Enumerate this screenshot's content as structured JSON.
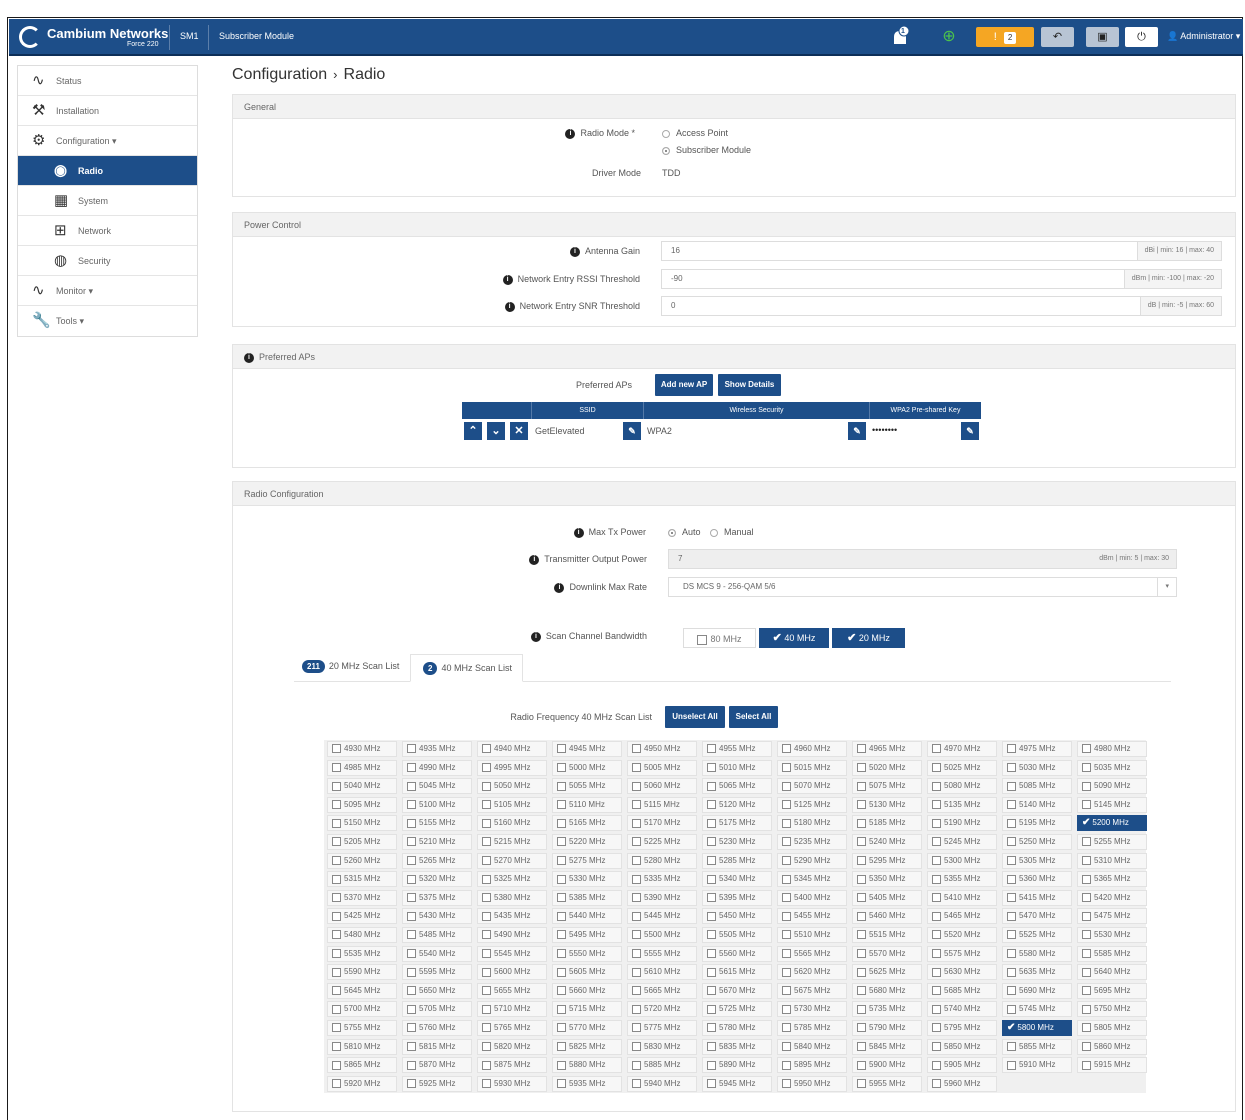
{
  "header": {
    "brand": "Cambium Networks",
    "product": "Force 220",
    "device": "SM1",
    "mode": "Subscriber Module",
    "notif_count": "1",
    "alert_count": "2",
    "user": "Administrator"
  },
  "sidebar": {
    "items": [
      {
        "label": "Status",
        "icon": "pulse-icon"
      },
      {
        "label": "Installation",
        "icon": "walker-icon"
      },
      {
        "label": "Configuration",
        "icon": "gear-icon"
      },
      {
        "label": "Radio",
        "icon": "radio-icon"
      },
      {
        "label": "System",
        "icon": "system-icon"
      },
      {
        "label": "Network",
        "icon": "network-icon"
      },
      {
        "label": "Security",
        "icon": "security-icon"
      },
      {
        "label": "Monitor",
        "icon": "pulse-icon"
      },
      {
        "label": "Tools",
        "icon": "wrench-icon"
      }
    ]
  },
  "breadcrumb": {
    "parent": "Configuration",
    "current": "Radio"
  },
  "general": {
    "title": "General",
    "radio_mode_label": "Radio Mode",
    "options": [
      "Access Point",
      "Subscriber Module"
    ],
    "selected": "Subscriber Module",
    "driver_mode_label": "Driver Mode",
    "driver_mode_value": "TDD"
  },
  "power": {
    "title": "Power Control",
    "antenna_gain": {
      "label": "Antenna Gain",
      "value": "16",
      "unit": "dBi | min: 16 | max: 40"
    },
    "rssi": {
      "label": "Network Entry RSSI Threshold",
      "value": "-90",
      "unit": "dBm | min: -100 | max: -20"
    },
    "snr": {
      "label": "Network Entry SNR Threshold",
      "value": "0",
      "unit": "dB | min: -5 | max: 60"
    }
  },
  "preferred": {
    "title": "Preferred APs",
    "label": "Preferred APs",
    "add_label": "Add new AP",
    "show_label": "Show Details",
    "cols": [
      "SSID",
      "Wireless Security",
      "WPA2 Pre-shared Key"
    ],
    "row": {
      "ssid": "GetElevated",
      "security": "WPA2",
      "key": "••••••••"
    }
  },
  "radio_config": {
    "title": "Radio Configuration",
    "max_tx_label": "Max Tx Power",
    "max_tx_options": [
      "Auto",
      "Manual"
    ],
    "max_tx_selected": "Auto",
    "tx_power": {
      "label": "Transmitter Output Power",
      "value": "7",
      "unit": "dBm | min: 5 | max: 30"
    },
    "dl_rate": {
      "label": "Downlink Max Rate",
      "value": "DS MCS 9 - 256-QAM 5/6"
    },
    "scan_bw_label": "Scan Channel Bandwidth",
    "bw_options": [
      {
        "label": "80 MHz",
        "checked": false
      },
      {
        "label": "40 MHz",
        "checked": true
      },
      {
        "label": "20 MHz",
        "checked": true
      }
    ],
    "tab20": {
      "count": "211",
      "label": "20 MHz Scan List"
    },
    "tab40": {
      "count": "2",
      "label": "40 MHz Scan List"
    },
    "scan_list_label": "Radio Frequency 40 MHz Scan List",
    "unselect_label": "Unselect All",
    "select_label": "Select All",
    "selected_freqs": [
      "5200 MHz",
      "5800 MHz"
    ]
  }
}
